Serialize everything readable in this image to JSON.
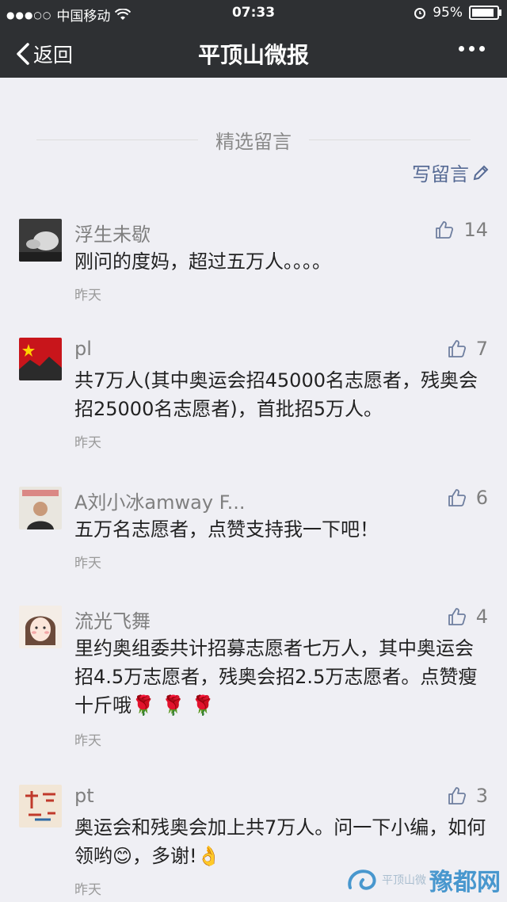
{
  "status": {
    "carrier": "中国移动",
    "time": "07:33",
    "battery": "95%",
    "battery_level": 0.95
  },
  "nav": {
    "back_label": "返回",
    "title": "平顶山微报"
  },
  "section": {
    "title": "精选留言",
    "write_label": "写留言"
  },
  "comments": [
    {
      "name": "浮生未歇",
      "likes": "14",
      "text": "刚问的度妈，超过五万人。。。。",
      "date": "昨天"
    },
    {
      "name": "pl",
      "likes": "7",
      "text": "共7万人(其中奥运会招45000名志愿者，残奥会招25000名志愿者)，首批招5万人。",
      "date": "昨天"
    },
    {
      "name": "A刘小冰amway F...",
      "likes": "6",
      "text": "五万名志愿者，点赞支持我一下吧！",
      "date": "昨天"
    },
    {
      "name": "流光飞舞",
      "likes": "4",
      "text": "里约奥组委共计招募志愿者七万人，其中奥运会招4.5万志愿者，残奥会招2.5万志愿者。点赞瘦十斤哦🌹 🌹 🌹",
      "date": "昨天"
    },
    {
      "name": "pt",
      "likes": "3",
      "text": "奥运会和残奥会加上共7万人。问一下小编，如何领哟😊，多谢!👌",
      "date": "昨天"
    }
  ],
  "watermark": {
    "text": "豫都网",
    "sub": "平顶山微"
  }
}
